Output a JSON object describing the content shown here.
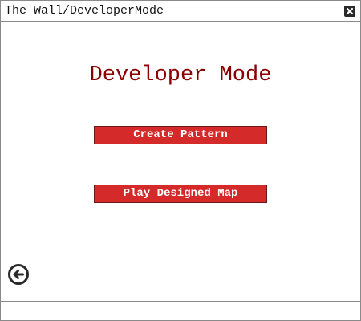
{
  "window": {
    "title": "The Wall/DeveloperMode",
    "close_icon": "close-icon"
  },
  "main": {
    "heading": "Developer Mode",
    "buttons": [
      {
        "label": "Create Pattern"
      },
      {
        "label": "Play Designed Map"
      }
    ],
    "back_icon": "arrow-left-circle-icon"
  },
  "colors": {
    "heading": "#8b0000",
    "button_bg": "#d42a2a",
    "button_text": "#ffffff"
  }
}
